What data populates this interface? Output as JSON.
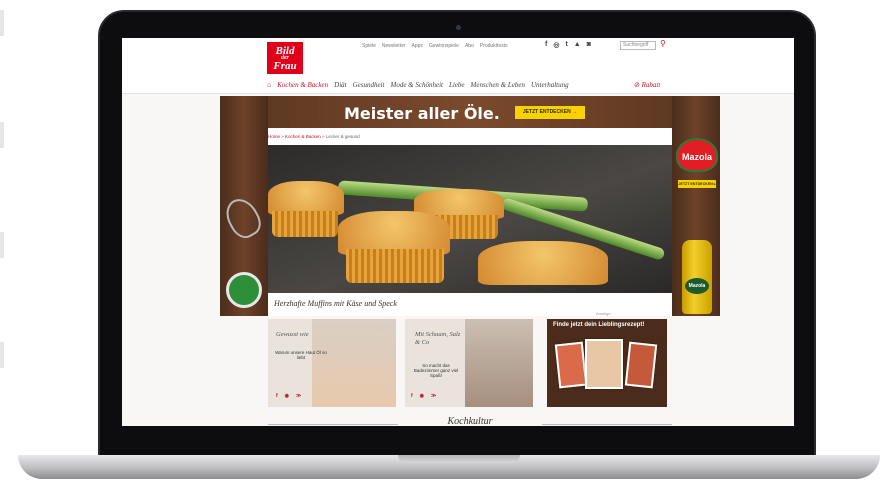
{
  "site": {
    "logo_line1": "Bild",
    "logo_line2": "der",
    "logo_line3": "Frau"
  },
  "topnav": [
    "Spiele",
    "Newsletter",
    "Apps",
    "Gewinnspiele",
    "Abo",
    "Produkttests"
  ],
  "social": [
    "f",
    "◎",
    "t",
    "▲",
    "◙"
  ],
  "search": {
    "placeholder": "Suchbegriff"
  },
  "mainnav": {
    "items": [
      "Kochen & Backen",
      "Diät",
      "Gesundheit",
      "Mode & Schönheit",
      "Liebe",
      "Menschen & Leben",
      "Unterhaltung"
    ],
    "rabatt": "Rabatt"
  },
  "ad": {
    "headline": "Meister aller Öle.",
    "cta": "JETZT ENTDECKEN →",
    "brand": "Mazola",
    "brand_cta": "JETZT ENTDECKEN ▸"
  },
  "breadcrumb": {
    "home": "Home",
    "section": "Kochen & Backen",
    "current": "Lecker & gesund"
  },
  "hero": {
    "caption": "Herzhafte Muffins mit Käse und Speck"
  },
  "teasers": [
    {
      "title": "Gewusst wie",
      "sub": "Warum unsere Haut Öl so liebt"
    },
    {
      "title": "Mit Schaum, Salz & Co",
      "sub": "So macht das Badezimmer ganz viel Spaß!"
    }
  ],
  "ad_small": {
    "label": "Anzeige",
    "title": "Finde jetzt dein Lieblingsrezept!"
  },
  "section": {
    "title": "Kochkultur"
  }
}
